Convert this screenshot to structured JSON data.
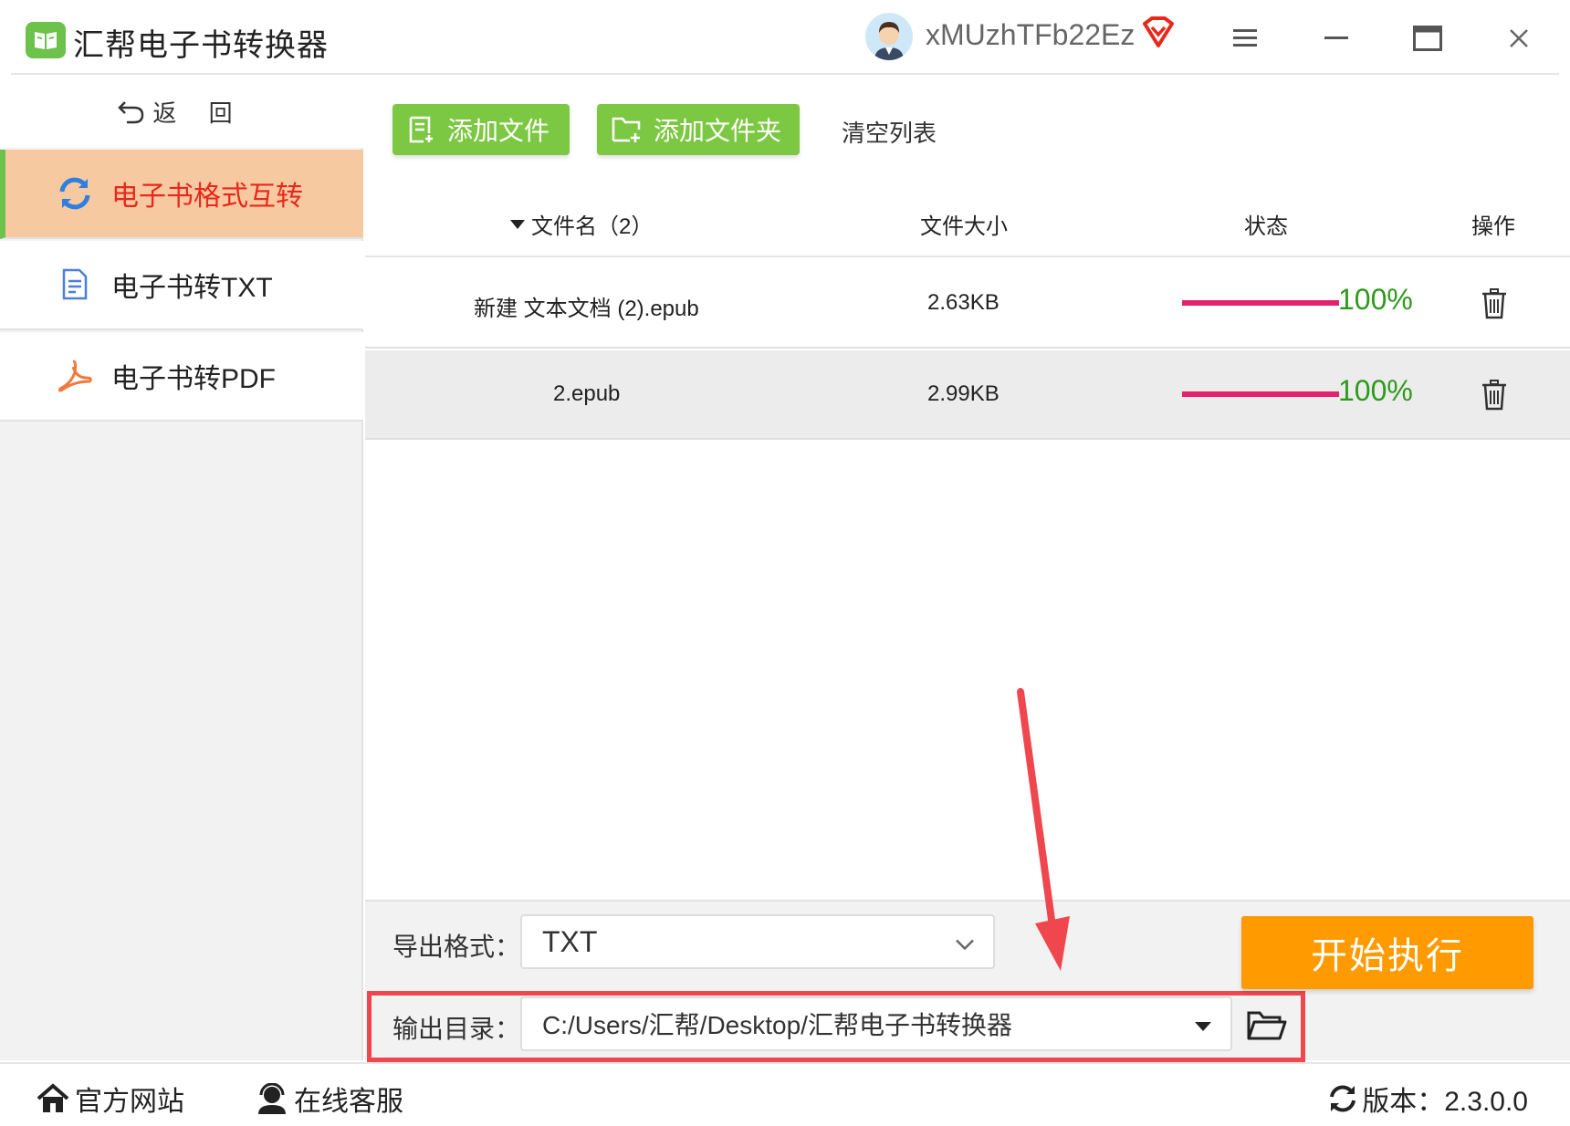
{
  "app": {
    "title": "汇帮电子书转换器"
  },
  "user": {
    "name": "xMUzhTFb22Ez"
  },
  "sidebar": {
    "back_label": "返 回",
    "items": [
      {
        "label": "电子书格式互转",
        "icon": "refresh-icon",
        "active": true
      },
      {
        "label": "电子书转TXT",
        "icon": "document-icon",
        "active": false
      },
      {
        "label": "电子书转PDF",
        "icon": "pdf-icon",
        "active": false
      }
    ]
  },
  "toolbar": {
    "add_file": "添加文件",
    "add_folder": "添加文件夹",
    "clear_list": "清空列表"
  },
  "table": {
    "headers": {
      "name": "文件名（2）",
      "size": "文件大小",
      "status": "状态",
      "action": "操作"
    },
    "rows": [
      {
        "name": "新建 文本文档 (2).epub",
        "size": "2.63KB",
        "progress": 1.0,
        "percent": "100%"
      },
      {
        "name": "2.epub",
        "size": "2.99KB",
        "progress": 1.0,
        "percent": "100%"
      }
    ]
  },
  "export": {
    "format_label": "导出格式：",
    "format_value": "TXT",
    "dir_label": "输出目录：",
    "dir_value": "C:/Users/汇帮/Desktop/汇帮电子书转换器"
  },
  "start_button": "开始执行",
  "footer": {
    "website": "官方网站",
    "support": "在线客服",
    "version": "版本：2.3.0.0"
  },
  "colors": {
    "brand_green": "#7dc843",
    "active_bg": "#f7c9a0",
    "active_text": "#e8281c",
    "progress": "#e2236c",
    "percent": "#2e9a1c",
    "start": "#ff9a00",
    "highlight": "#f0474f"
  }
}
